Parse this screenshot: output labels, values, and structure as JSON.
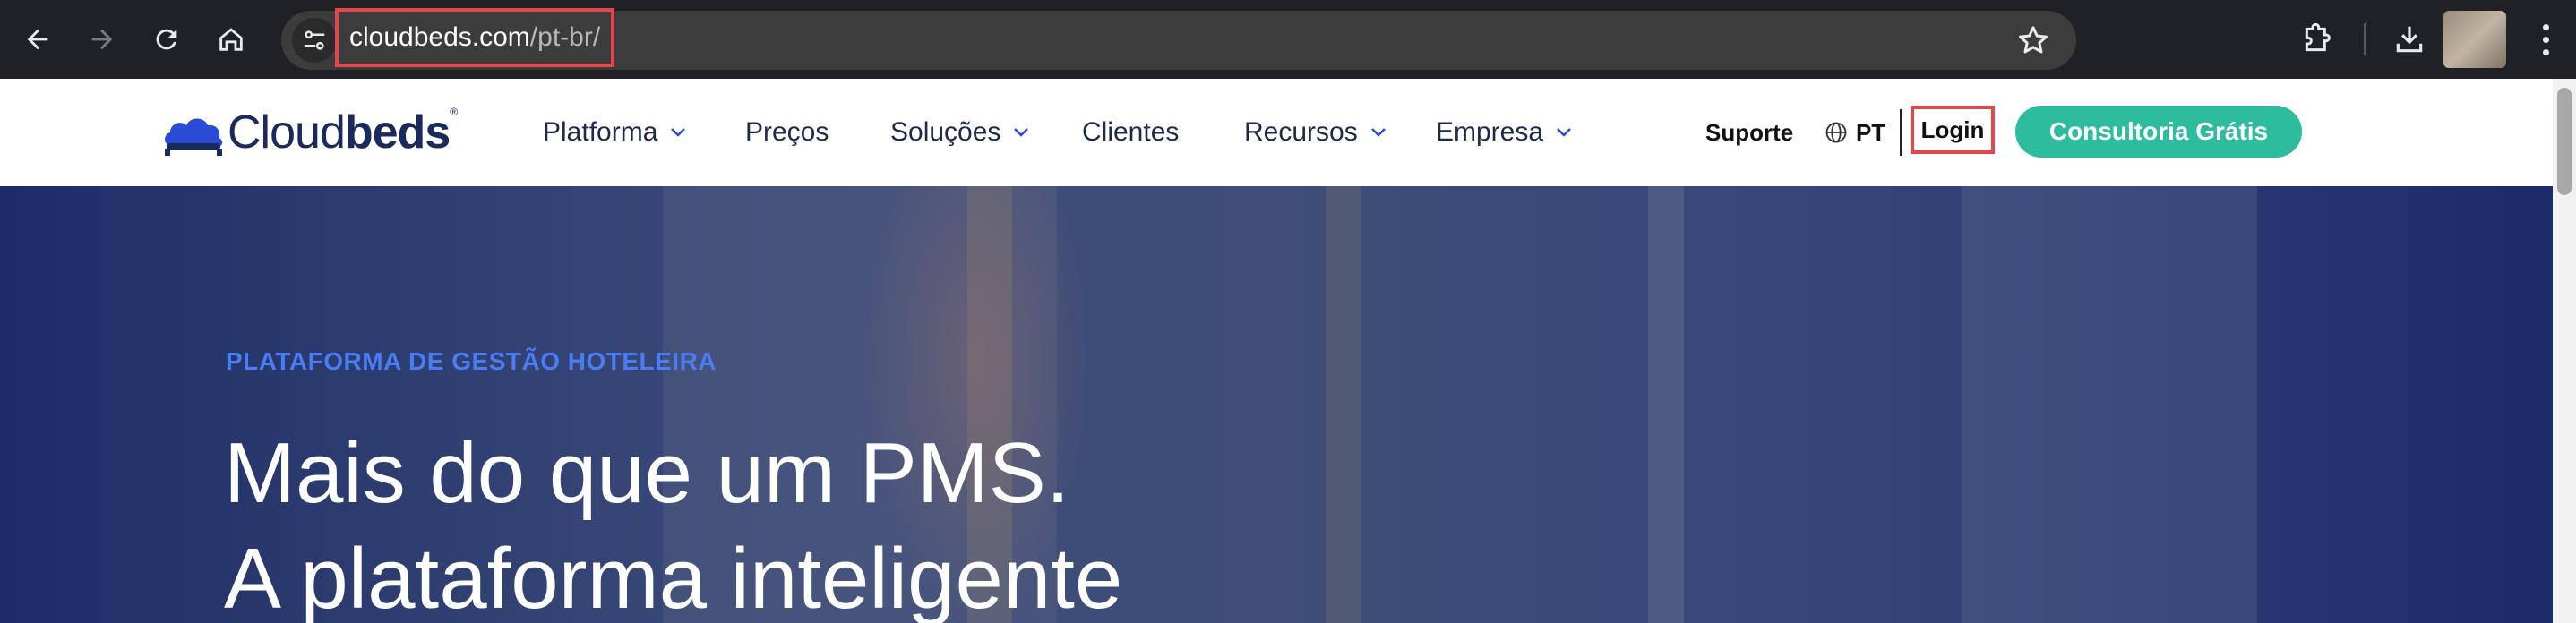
{
  "browser": {
    "url_host": "cloudbeds.com",
    "url_path": "/pt-br/"
  },
  "header": {
    "logo_text_light": "Cloud",
    "logo_text_bold": "beds",
    "logo_reg": "®",
    "nav": [
      {
        "label": "Platforma",
        "has_dropdown": true
      },
      {
        "label": "Preços",
        "has_dropdown": false
      },
      {
        "label": "Soluções",
        "has_dropdown": true
      },
      {
        "label": "Clientes",
        "has_dropdown": false
      },
      {
        "label": "Recursos",
        "has_dropdown": true
      },
      {
        "label": "Empresa",
        "has_dropdown": true
      }
    ],
    "support_label": "Suporte",
    "language_label": "PT",
    "login_label": "Login",
    "cta_label": "Consultoria Grátis"
  },
  "hero": {
    "eyebrow": "PLATAFORMA DE GESTÃO HOTELEIRA",
    "title_line1": "Mais do que um PMS.",
    "title_line2": "A plataforma inteligente"
  },
  "colors": {
    "accent_blue": "#4a7cf4",
    "cta_green": "#2dbc9e",
    "highlight_red": "#e4464e",
    "brand_navy": "#1b2a5c"
  }
}
